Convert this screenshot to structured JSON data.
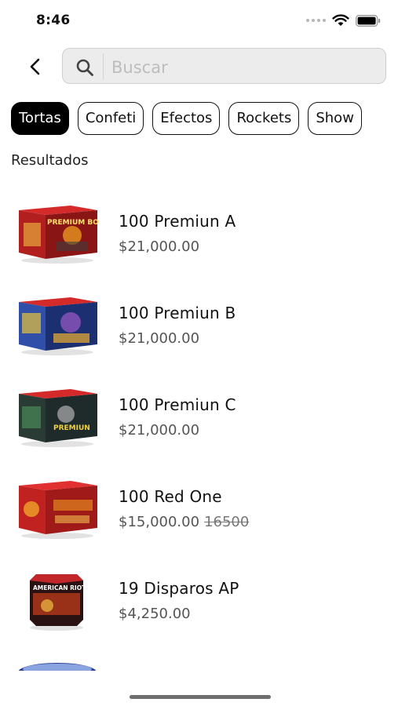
{
  "status_bar": {
    "time": "8:46"
  },
  "search": {
    "placeholder": "Buscar",
    "value": ""
  },
  "categories": [
    "Tortas",
    "Confeti",
    "Efectos",
    "Rockets",
    "Show"
  ],
  "active_category": "Tortas",
  "section_label": "Resultados",
  "products": [
    {
      "name": "100 Premiun A",
      "price": "$21,000.00",
      "old_price": "",
      "box_label": "PREMIUM BO"
    },
    {
      "name": "100 Premiun B",
      "price": "$21,000.00",
      "old_price": "",
      "box_label": ""
    },
    {
      "name": "100 Premiun C",
      "price": "$21,000.00",
      "old_price": "",
      "box_label": "PREMIUN"
    },
    {
      "name": "100 Red One",
      "price": "$15,000.00",
      "old_price": "16500",
      "box_label": ""
    },
    {
      "name": "19 Disparos AP",
      "price": "$4,250.00",
      "old_price": "",
      "box_label": "AMERICAN RIOT"
    }
  ],
  "colors": {
    "accent": "#000000",
    "search_bg": "#ececec",
    "box_red": "#d42a2a"
  },
  "icons": [
    "back-chevron-icon",
    "search-icon",
    "wifi-icon",
    "battery-icon",
    "cellular-dots-icon"
  ]
}
